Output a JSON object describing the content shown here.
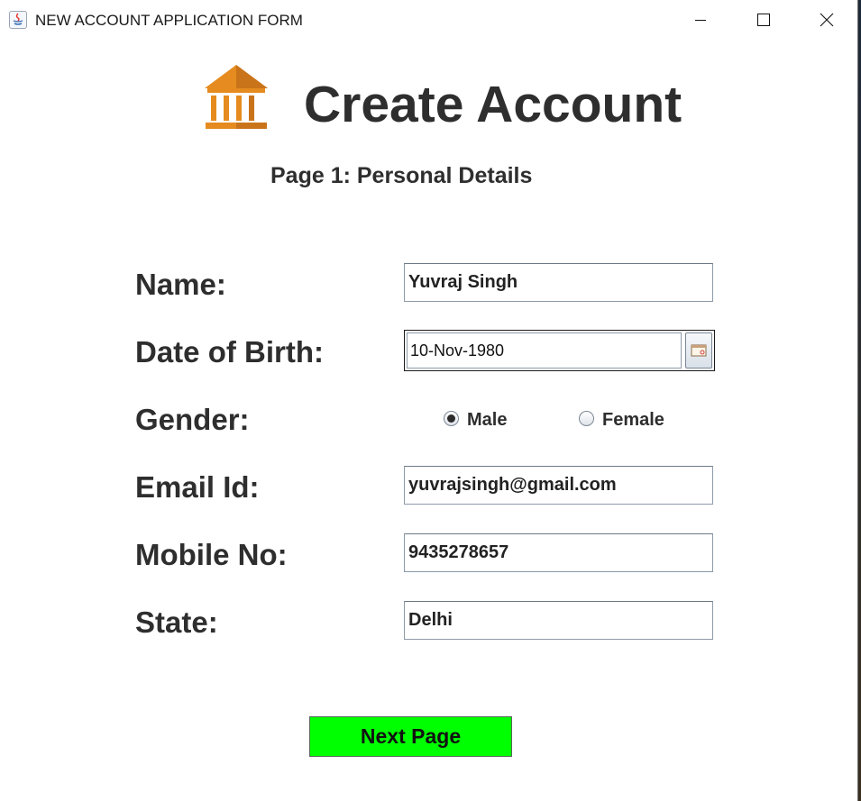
{
  "window": {
    "title": "NEW ACCOUNT APPLICATION FORM"
  },
  "header": {
    "title": "Create Account",
    "subtitle": "Page 1: Personal Details",
    "icon": "bank-icon"
  },
  "form": {
    "name_label": "Name:",
    "name_value": "Yuvraj Singh",
    "dob_label": "Date of Birth:",
    "dob_value": "10-Nov-1980",
    "gender_label": "Gender:",
    "gender_options": [
      {
        "label": "Male",
        "selected": true
      },
      {
        "label": "Female",
        "selected": false
      }
    ],
    "email_label": "Email Id:",
    "email_value": "yuvrajsingh@gmail.com",
    "mobile_label": "Mobile No:",
    "mobile_value": "9435278657",
    "state_label": "State:",
    "state_value": "Delhi"
  },
  "actions": {
    "next_label": "Next Page"
  },
  "colors": {
    "next_button": "#00ff00",
    "icon": "#e68a1e",
    "text": "#2e2e2e"
  }
}
